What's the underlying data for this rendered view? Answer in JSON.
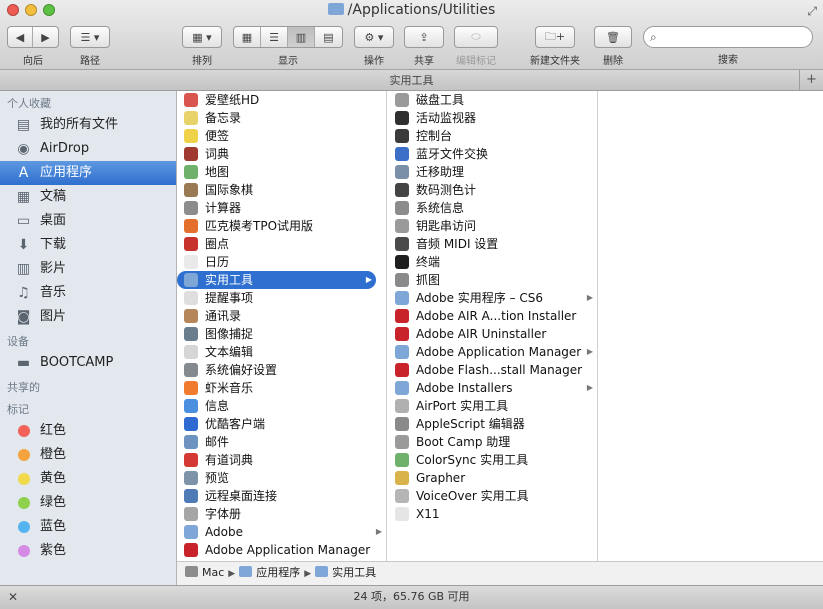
{
  "window": {
    "title": "/Applications/Utilities"
  },
  "toolbar": {
    "back_label": "向后",
    "path_label": "路径",
    "arrange_label": "排列",
    "view_label": "显示",
    "action_label": "操作",
    "share_label": "共享",
    "edit_tags_label": "编辑标记",
    "new_folder_label": "新建文件夹",
    "delete_label": "删除",
    "search_label": "搜索"
  },
  "tab": {
    "label": "实用工具"
  },
  "sidebar": {
    "favorites_header": "个人收藏",
    "favorites": [
      {
        "label": "我的所有文件",
        "icon": "all-files-icon"
      },
      {
        "label": "AirDrop",
        "icon": "airdrop-icon"
      },
      {
        "label": "应用程序",
        "icon": "applications-icon",
        "selected": true
      },
      {
        "label": "文稿",
        "icon": "documents-icon"
      },
      {
        "label": "桌面",
        "icon": "desktop-icon"
      },
      {
        "label": "下载",
        "icon": "downloads-icon"
      },
      {
        "label": "影片",
        "icon": "movies-icon"
      },
      {
        "label": "音乐",
        "icon": "music-icon"
      },
      {
        "label": "图片",
        "icon": "pictures-icon"
      }
    ],
    "devices_header": "设备",
    "devices": [
      {
        "label": "BOOTCAMP",
        "icon": "disk-icon"
      }
    ],
    "shared_header": "共享的",
    "tags_header": "标记",
    "tags": [
      {
        "label": "红色",
        "color": "#f2625a"
      },
      {
        "label": "橙色",
        "color": "#f5a33f"
      },
      {
        "label": "黄色",
        "color": "#f1da4a"
      },
      {
        "label": "绿色",
        "color": "#8fd04d"
      },
      {
        "label": "蓝色",
        "color": "#55b4f0"
      },
      {
        "label": "紫色",
        "color": "#d58ae6"
      }
    ]
  },
  "column1": [
    {
      "label": "爱壁纸HD",
      "color": "#d9554f"
    },
    {
      "label": "备忘录",
      "color": "#e8d36a"
    },
    {
      "label": "便签",
      "color": "#f0d24a"
    },
    {
      "label": "词典",
      "color": "#a0392f"
    },
    {
      "label": "地图",
      "color": "#6fb06a"
    },
    {
      "label": "国际象棋",
      "color": "#9a7a55"
    },
    {
      "label": "计算器",
      "color": "#8c8c8c"
    },
    {
      "label": "匹克模考TPO试用版",
      "color": "#e46e2b"
    },
    {
      "label": "圈点",
      "color": "#c8322d"
    },
    {
      "label": "日历",
      "color": "#e9e9e9"
    },
    {
      "label": "实用工具",
      "color": "#7ea7d8",
      "folder": true,
      "selected": true
    },
    {
      "label": "提醒事项",
      "color": "#dedede"
    },
    {
      "label": "通讯录",
      "color": "#b4865a"
    },
    {
      "label": "图像捕捉",
      "color": "#6a7d8c"
    },
    {
      "label": "文本编辑",
      "color": "#d6d6d6"
    },
    {
      "label": "系统偏好设置",
      "color": "#858a8f"
    },
    {
      "label": "虾米音乐",
      "color": "#f07a2e"
    },
    {
      "label": "信息",
      "color": "#4a8fe0"
    },
    {
      "label": "优酷客户端",
      "color": "#2f6ad0"
    },
    {
      "label": "邮件",
      "color": "#6e93c0"
    },
    {
      "label": "有道词典",
      "color": "#d43a33"
    },
    {
      "label": "预览",
      "color": "#7d93a8"
    },
    {
      "label": "远程桌面连接",
      "color": "#4e7bb5"
    },
    {
      "label": "字体册",
      "color": "#a5a5a5"
    },
    {
      "label": "Adobe",
      "color": "#7ea7d8",
      "folder": true
    },
    {
      "label": "Adobe Application Manager",
      "color": "#c8222a"
    }
  ],
  "column2": [
    {
      "label": "磁盘工具",
      "color": "#9a9a9a"
    },
    {
      "label": "活动监视器",
      "color": "#2f2f2f"
    },
    {
      "label": "控制台",
      "color": "#3a3a3a"
    },
    {
      "label": "蓝牙文件交换",
      "color": "#3b6fc8"
    },
    {
      "label": "迁移助理",
      "color": "#7a8fa8"
    },
    {
      "label": "数码测色计",
      "color": "#444444"
    },
    {
      "label": "系统信息",
      "color": "#8c8c8c"
    },
    {
      "label": "钥匙串访问",
      "color": "#9a9a9a"
    },
    {
      "label": "音频 MIDI 设置",
      "color": "#4a4a4a"
    },
    {
      "label": "终端",
      "color": "#1f1f1f"
    },
    {
      "label": "抓图",
      "color": "#8a8a8a"
    },
    {
      "label": "Adobe 实用程序 – CS6",
      "color": "#7ea7d8",
      "folder": true
    },
    {
      "label": "Adobe AIR A...tion Installer",
      "color": "#c8222a"
    },
    {
      "label": "Adobe AIR Uninstaller",
      "color": "#c8222a"
    },
    {
      "label": "Adobe Application Manager",
      "color": "#7ea7d8",
      "folder": true
    },
    {
      "label": "Adobe Flash...stall Manager",
      "color": "#c8222a"
    },
    {
      "label": "Adobe Installers",
      "color": "#7ea7d8",
      "folder": true
    },
    {
      "label": "AirPort 实用工具",
      "color": "#b0b0b0"
    },
    {
      "label": "AppleScript 编辑器",
      "color": "#8a8a8a"
    },
    {
      "label": "Boot Camp 助理",
      "color": "#9a9a9a"
    },
    {
      "label": "ColorSync 实用工具",
      "color": "#6fb06a"
    },
    {
      "label": "Grapher",
      "color": "#d9b24a"
    },
    {
      "label": "VoiceOver 实用工具",
      "color": "#b5b5b5"
    },
    {
      "label": "X11",
      "color": "#e5e5e5"
    }
  ],
  "pathbar": [
    {
      "label": "Mac",
      "color": "#8c8c8c"
    },
    {
      "label": "应用程序",
      "color": "#7ea7d8"
    },
    {
      "label": "实用工具",
      "color": "#7ea7d8"
    }
  ],
  "status": {
    "text": "24 项，65.76 GB 可用"
  }
}
